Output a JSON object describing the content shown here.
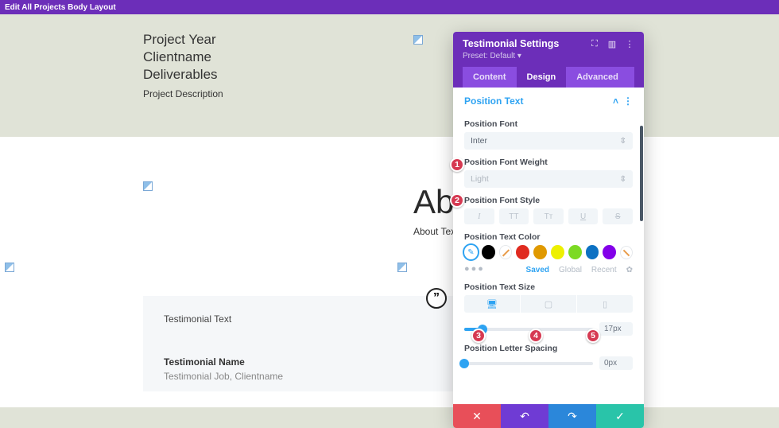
{
  "topbar": {
    "title": "Edit All Projects Body Layout"
  },
  "project": {
    "year": "Project Year",
    "client": "Clientname",
    "deliverables": "Deliverables",
    "description": "Project Description"
  },
  "about": {
    "heading": "About",
    "text": "About Text"
  },
  "testimonial": {
    "text": "Testimonial Text",
    "name": "Testimonial Name",
    "job": "Testimonial Job, Clientname",
    "quote_glyph": "”"
  },
  "panel": {
    "title": "Testimonial Settings",
    "preset": "Preset: Default ▾",
    "tabs": {
      "content": "Content",
      "design": "Design",
      "advanced": "Advanced"
    },
    "section": "Position Text",
    "labels": {
      "font": "Position Font",
      "weight": "Position Font Weight",
      "style": "Position Font Style",
      "color": "Position Text Color",
      "size": "Position Text Size",
      "spacing": "Position Letter Spacing"
    },
    "values": {
      "font": "Inter",
      "weight": "Light",
      "size": "17px",
      "spacing": "0px",
      "size_pct": 14,
      "spacing_pct": 0
    },
    "style_buttons": {
      "italic": "I",
      "uppercase": "TT",
      "smallcaps": "Tᴛ",
      "underline": "U",
      "strike": "S"
    },
    "colors": [
      "#000000",
      "#ffffff",
      "#e02b20",
      "#e09900",
      "#edf000",
      "#7cda24",
      "#0c71c3",
      "#8300e9"
    ],
    "scope": {
      "saved": "Saved",
      "global": "Global",
      "recent": "Recent"
    }
  },
  "badges": {
    "b1": "1",
    "b2": "2",
    "b3": "3",
    "b4": "4",
    "b5": "5"
  }
}
